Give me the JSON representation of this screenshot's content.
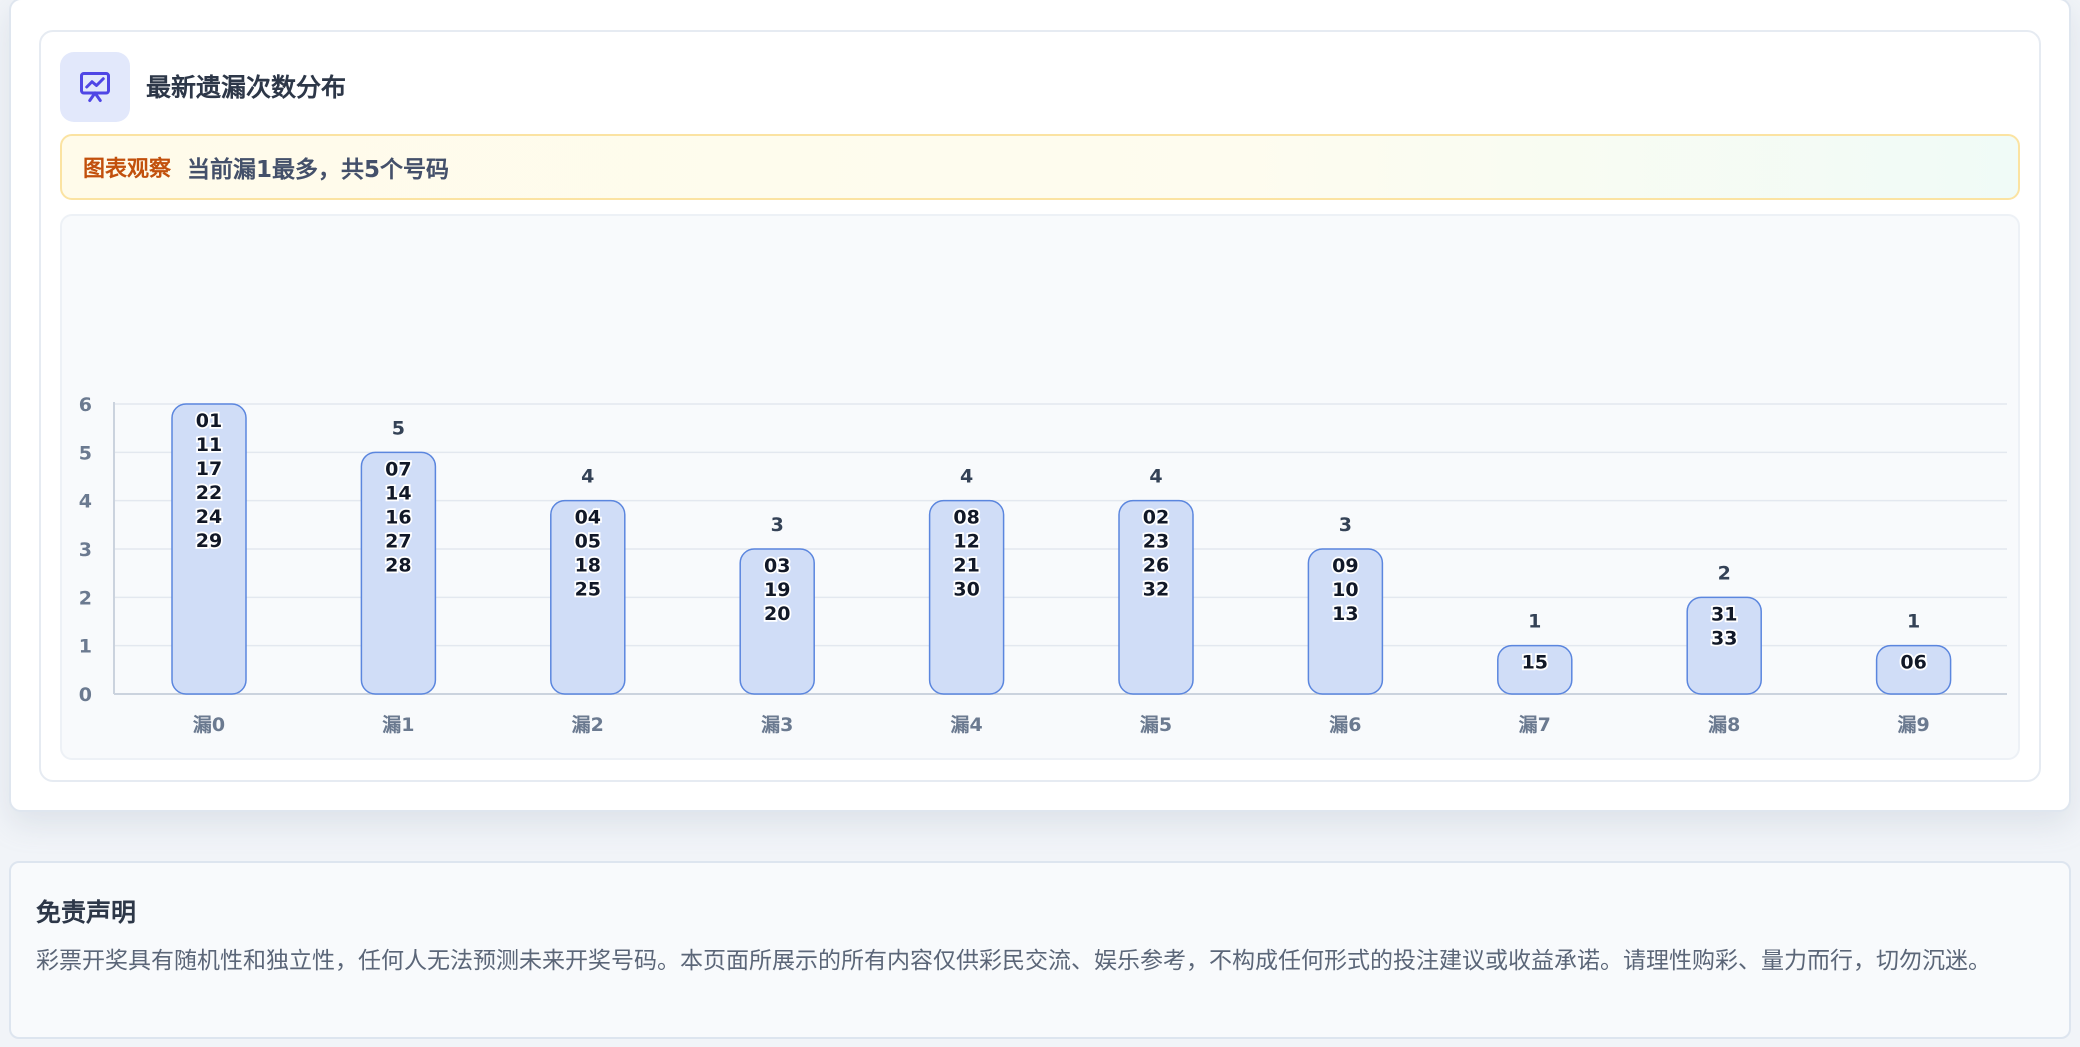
{
  "section": {
    "title": "最新遗漏次数分布",
    "icon": "chart-presentation-icon",
    "note_label": "图表观察",
    "note_text": "当前漏1最多，共5个号码"
  },
  "colors": {
    "accent": "#4f46e5",
    "bar_fill": "#d0ddf7",
    "bar_stroke": "#5b86de",
    "note_label": "#c2500c"
  },
  "chart_data": {
    "type": "bar",
    "categories": [
      "漏0",
      "漏1",
      "漏2",
      "漏3",
      "漏4",
      "漏5",
      "漏6",
      "漏7",
      "漏8",
      "漏9"
    ],
    "values": [
      6,
      5,
      4,
      3,
      4,
      4,
      3,
      1,
      2,
      1
    ],
    "value_labels": [
      "",
      "5",
      "4",
      "3",
      "4",
      "4",
      "3",
      "1",
      "2",
      "1"
    ],
    "bar_numbers": [
      [
        "01",
        "11",
        "17",
        "22",
        "24",
        "29"
      ],
      [
        "07",
        "14",
        "16",
        "27",
        "28"
      ],
      [
        "04",
        "05",
        "18",
        "25"
      ],
      [
        "03",
        "19",
        "20"
      ],
      [
        "08",
        "12",
        "21",
        "30"
      ],
      [
        "02",
        "23",
        "26",
        "32"
      ],
      [
        "09",
        "10",
        "13"
      ],
      [
        "15"
      ],
      [
        "31",
        "33"
      ],
      [
        "06"
      ]
    ],
    "yticks": [
      0,
      1,
      2,
      3,
      4,
      5,
      6
    ],
    "ylim": [
      0,
      6
    ],
    "grid": true,
    "xlabel": "",
    "ylabel": "",
    "title": ""
  },
  "disclaimer": {
    "title": "免责声明",
    "body": "彩票开奖具有随机性和独立性，任何人无法预测未来开奖号码。本页面所展示的所有内容仅供彩民交流、娱乐参考，不构成任何形式的投注建议或收益承诺。请理性购彩、量力而行，切勿沉迷。"
  }
}
